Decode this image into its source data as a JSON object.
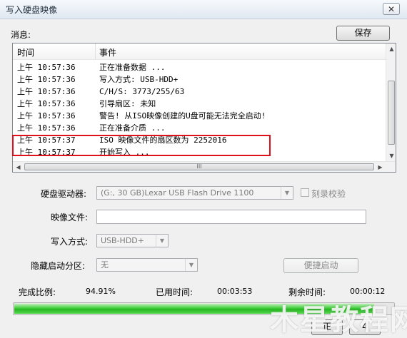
{
  "window": {
    "title": "写入硬盘映像",
    "close_glyph": "✕"
  },
  "messages": {
    "label": "消息:",
    "save_label": "保存",
    "columns": [
      "时间",
      "事件"
    ],
    "rows": [
      {
        "time": "上午 10:57:36",
        "event": "正在准备数据 ..."
      },
      {
        "time": "上午 10:57:36",
        "event": "写入方式: USB-HDD+"
      },
      {
        "time": "上午 10:57:36",
        "event": "C/H/S: 3773/255/63"
      },
      {
        "time": "上午 10:57:36",
        "event": "引导扇区: 未知"
      },
      {
        "time": "上午 10:57:36",
        "event": "警告! 从ISO映像创建的U盘可能无法完全启动!"
      },
      {
        "time": "上午 10:57:36",
        "event": "正在准备介质 ..."
      },
      {
        "time": "上午 10:57:37",
        "event": "ISO 映像文件的扇区数为 2252016"
      },
      {
        "time": "上午 10:57:37",
        "event": "开始写入 ..."
      }
    ],
    "hscroll_grip": "III"
  },
  "form": {
    "drive_label": "硬盘驱动器:",
    "drive_value": "(G:, 30 GB)Lexar   USB Flash Drive 1100",
    "verify_label": "刻录校验",
    "image_label": "映像文件:",
    "image_value": "",
    "write_mode_label": "写入方式:",
    "write_mode_value": "USB-HDD+",
    "hidden_partition_label": "隐藏启动分区:",
    "hidden_partition_value": "无",
    "boot_button_label": "便捷启动"
  },
  "status": {
    "percent_label": "完成比例:",
    "percent_value": "94.91%",
    "elapsed_label": "已用时间:",
    "elapsed_value": "00:03:53",
    "remaining_label": "剩余时间:",
    "remaining_value": "00:00:12",
    "progress_fraction": 0.9491
  },
  "footer": {
    "partial_button_1": "正",
    "partial_button_2": "4"
  },
  "watermark": "木星教程网"
}
